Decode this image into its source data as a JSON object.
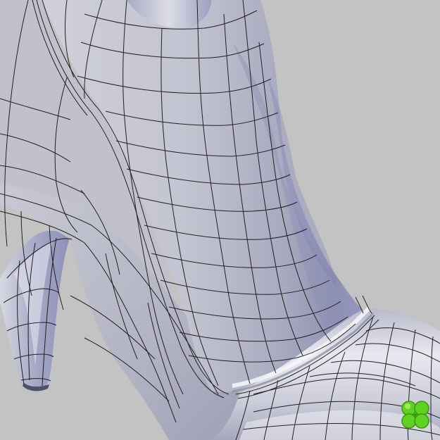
{
  "scene": {
    "subject": "shoe-model",
    "colors": {
      "background": "#c3c3c3",
      "surface_light": "#e6e7ee",
      "surface_mid": "#b4b5c3",
      "surface_dark": "#8f90a6",
      "surface_blue": "#9496c4",
      "wire": "#141414"
    }
  },
  "logo": {
    "icon": "four-leaf-clover-icon",
    "color": "#5fd11f",
    "color_dark": "#3a9a10",
    "color_light": "#b8f06a"
  }
}
